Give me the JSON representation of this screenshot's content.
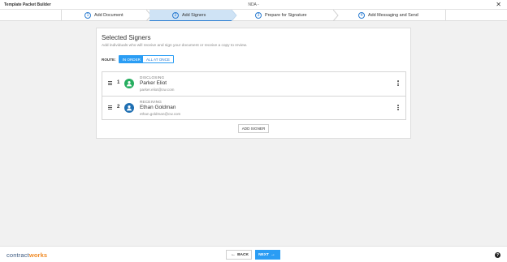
{
  "window": {
    "app_title": "Template Packet Builder",
    "doc_title": "NDA -",
    "close_glyph": "✕"
  },
  "steps": [
    {
      "num": "1",
      "label": "Add Document"
    },
    {
      "num": "2",
      "label": "Add Signers"
    },
    {
      "num": "3",
      "label": "Prepare for Signature"
    },
    {
      "num": "4",
      "label": "Add Messaging and Send"
    }
  ],
  "active_step": 2,
  "panel": {
    "title": "Selected Signers",
    "subtitle": "Add individuals who will receive and sign your document or receive a copy to review.",
    "route_label": "ROUTE:",
    "route_options": [
      "IN ORDER",
      "ALL AT ONCE"
    ],
    "route_selected": "IN ORDER"
  },
  "signers": [
    {
      "order": "1",
      "role": "DISCLOSING",
      "name": "Parker Eliot",
      "email": "parker.eliot@cw.com",
      "avatar_color": "#27ae60",
      "avatar_icon": "user-icon"
    },
    {
      "order": "2",
      "role": "RECEIVING",
      "name": "Ethan Goldman",
      "email": "ethan.goldman@cw.com",
      "avatar_color": "#1f6fb2",
      "avatar_icon": "user-icon"
    }
  ],
  "add_signer_label": "ADD SIGNER",
  "footer": {
    "logo_part1": "contract",
    "logo_part2": "works",
    "back_label": "BACK",
    "next_label": "NEXT",
    "help_glyph": "?"
  },
  "colors": {
    "accent": "#2a9df4",
    "active_step_bg": "#cfe3f5",
    "logo_blue": "#3d5a80",
    "logo_orange": "#f08a24"
  }
}
